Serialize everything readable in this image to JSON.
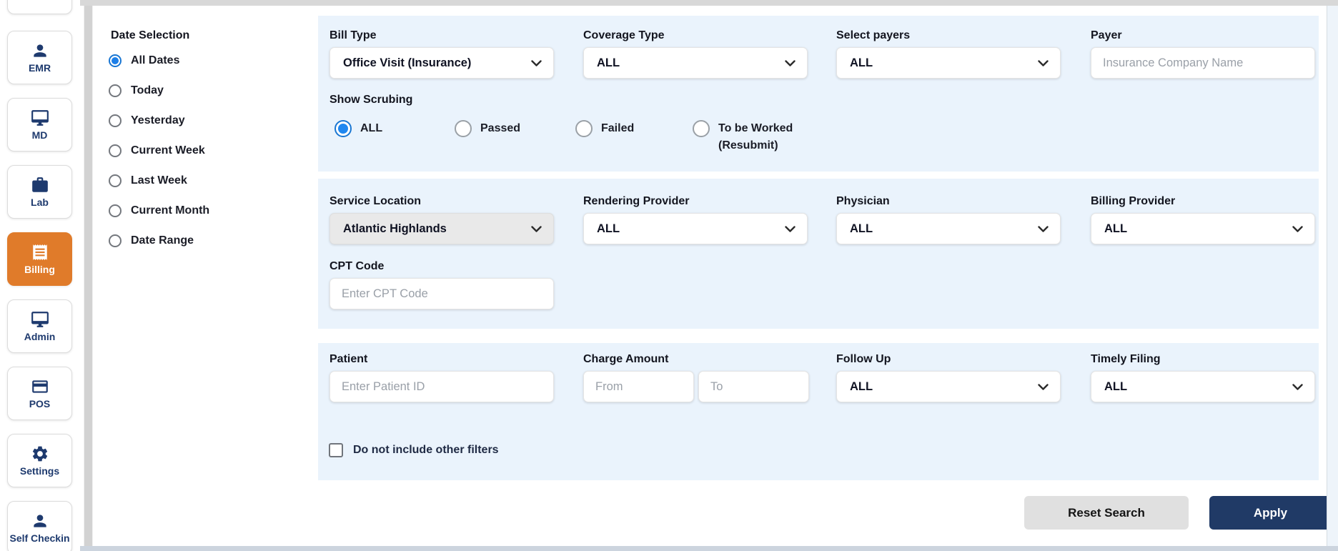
{
  "sidebar": {
    "items": [
      {
        "label": "EMR",
        "icon": "person-icon"
      },
      {
        "label": "MD",
        "icon": "monitor-icon"
      },
      {
        "label": "Lab",
        "icon": "briefcase-icon"
      },
      {
        "label": "Billing",
        "icon": "receipt-icon",
        "active": true
      },
      {
        "label": "Admin",
        "icon": "monitor-icon"
      },
      {
        "label": "POS",
        "icon": "credit-card-icon"
      },
      {
        "label": "Settings",
        "icon": "gear-icon"
      },
      {
        "label": "Self Checkin",
        "icon": "person-icon"
      }
    ]
  },
  "filters": {
    "date_selection": {
      "title": "Date Selection",
      "options": [
        "All Dates",
        "Today",
        "Yesterday",
        "Current Week",
        "Last Week",
        "Current Month",
        "Date Range"
      ],
      "selected": "All Dates"
    },
    "bill_type": {
      "label": "Bill Type",
      "value": "Office Visit (Insurance)"
    },
    "coverage_type": {
      "label": "Coverage Type",
      "value": "ALL"
    },
    "select_payers": {
      "label": "Select payers",
      "value": "ALL"
    },
    "payer": {
      "label": "Payer",
      "placeholder": "Insurance Company Name",
      "value": ""
    },
    "show_scrubbing": {
      "label": "Show Scrubing",
      "options": [
        "ALL",
        "Passed",
        "Failed",
        "To be Worked (Resubmit)"
      ],
      "selected": "ALL"
    },
    "service_location": {
      "label": "Service Location",
      "value": "Atlantic Highlands",
      "disabled": true
    },
    "rendering_provider": {
      "label": "Rendering Provider",
      "value": "ALL"
    },
    "physician": {
      "label": "Physician",
      "value": "ALL"
    },
    "billing_provider": {
      "label": "Billing Provider",
      "value": "ALL"
    },
    "cpt_code": {
      "label": "CPT Code",
      "placeholder": "Enter CPT Code",
      "value": ""
    },
    "patient": {
      "label": "Patient",
      "placeholder": "Enter Patient ID",
      "value": ""
    },
    "charge_amount": {
      "label": "Charge Amount",
      "from_placeholder": "From",
      "to_placeholder": "To"
    },
    "follow_up": {
      "label": "Follow Up",
      "value": "ALL"
    },
    "timely_filing": {
      "label": "Timely Filing",
      "value": "ALL"
    },
    "exclude_filter": {
      "label": "Do not include other filters",
      "checked": false
    }
  },
  "actions": {
    "reset": "Reset Search",
    "apply": "Apply"
  },
  "colors": {
    "accent_orange": "#e07b2a",
    "navy": "#1e3a6e",
    "radio_blue": "#1976d2",
    "panel_blue": "#eaf3fc",
    "apply_navy": "#203a66"
  }
}
